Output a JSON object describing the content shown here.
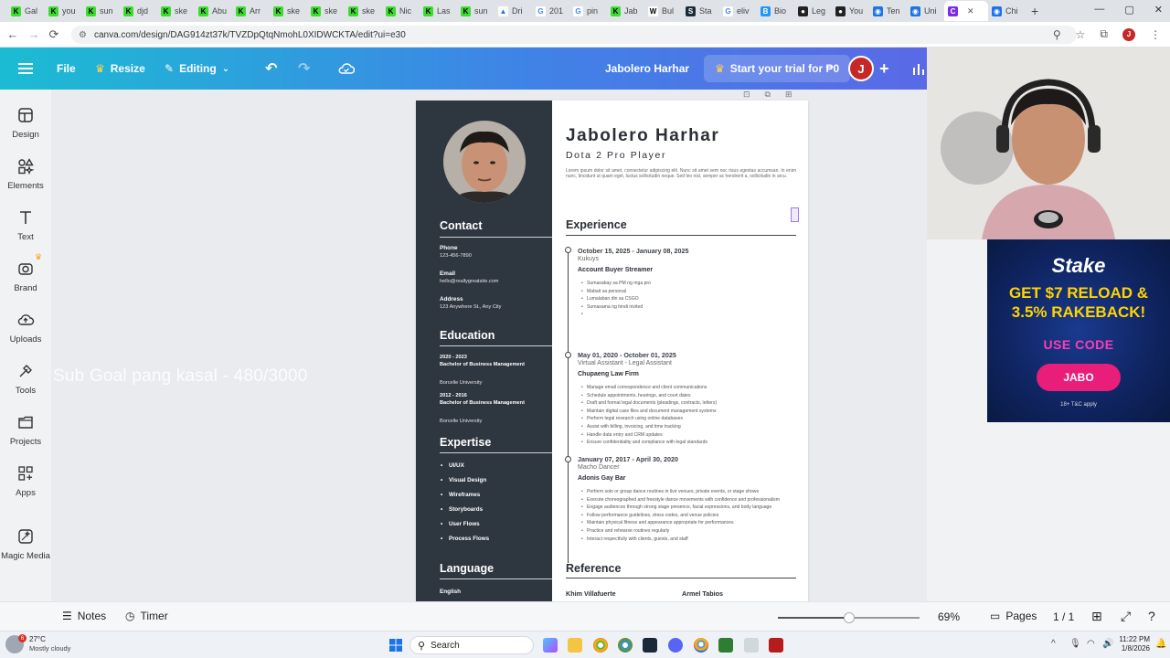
{
  "browser": {
    "tabs": [
      {
        "label": "Gal",
        "icon": "green-k-favicon"
      },
      {
        "label": "you",
        "icon": "green-k-favicon"
      },
      {
        "label": "sun",
        "icon": "green-k-favicon"
      },
      {
        "label": "djd",
        "icon": "green-k-favicon"
      },
      {
        "label": "ske",
        "icon": "green-k-favicon"
      },
      {
        "label": "Abu",
        "icon": "green-k-favicon"
      },
      {
        "label": "Arr",
        "icon": "green-k-favicon"
      },
      {
        "label": "ske",
        "icon": "green-k-favicon"
      },
      {
        "label": "ske",
        "icon": "green-k-favicon"
      },
      {
        "label": "ske",
        "icon": "green-k-favicon"
      },
      {
        "label": "Nic",
        "icon": "green-k-favicon"
      },
      {
        "label": "Las",
        "icon": "green-k-favicon"
      },
      {
        "label": "sun",
        "icon": "green-k-favicon"
      },
      {
        "label": "Dri",
        "icon": "drive-favicon"
      },
      {
        "label": "201",
        "icon": "google-favicon"
      },
      {
        "label": "pin",
        "icon": "google-favicon"
      },
      {
        "label": "Jab",
        "icon": "green-k-favicon"
      },
      {
        "label": "Bul",
        "icon": "wikipedia-favicon"
      },
      {
        "label": "Sta",
        "icon": "stake-favicon"
      },
      {
        "label": "eliv",
        "icon": "google-favicon"
      },
      {
        "label": "Bio",
        "icon": "bio-favicon"
      },
      {
        "label": "Leg",
        "icon": "github-favicon"
      },
      {
        "label": "You",
        "icon": "github-favicon"
      },
      {
        "label": "Ten",
        "icon": "globe-favicon"
      },
      {
        "label": "Uni",
        "icon": "globe-favicon"
      },
      {
        "label": "",
        "icon": "canva-favicon",
        "active": true
      },
      {
        "label": "Chi",
        "icon": "globe-favicon"
      }
    ],
    "url": "canva.com/design/DAG914zt37k/TVZDpQtqNmohL0XIDWCKTA/edit?ui=e30"
  },
  "canva_header": {
    "file_label": "File",
    "resize_label": "Resize",
    "editing_label": "Editing",
    "doc_title": "Jabolero Harhar",
    "trial_label": "Start your trial for ₱0",
    "avatar_letter": "J"
  },
  "sidebar": {
    "items": [
      {
        "label": "Design",
        "icon": "design-icon"
      },
      {
        "label": "Elements",
        "icon": "elements-icon"
      },
      {
        "label": "Text",
        "icon": "text-icon"
      },
      {
        "label": "Brand",
        "icon": "brand-icon"
      },
      {
        "label": "Uploads",
        "icon": "uploads-icon"
      },
      {
        "label": "Tools",
        "icon": "tools-icon"
      },
      {
        "label": "Projects",
        "icon": "projects-icon"
      },
      {
        "label": "Apps",
        "icon": "apps-icon"
      },
      {
        "label": "Magic Media",
        "icon": "magic-media-icon"
      }
    ]
  },
  "overlay_text": "Sub Goal pang kasal - 480/3000",
  "resume": {
    "name": "Jabolero Harhar",
    "role": "Dota 2 Pro Player",
    "summary": "Lorem ipsum dolor sit amet, consectetur adipiscing elit. Nunc sit amet sem nec risus egestas accumsan. In enim nunc, tincidunt ut quam eget, luctus sollicitudin neque. Sed leo nisl, semper ac hendrerit a, sollicitudin in arcu.",
    "contact": {
      "heading": "Contact",
      "phone_label": "Phone",
      "phone": "123-456-7890",
      "email_label": "Email",
      "email": "hello@reallygreatsite.com",
      "address_label": "Address",
      "address": "123 Anywhere St., Any City"
    },
    "education": {
      "heading": "Education",
      "entries": [
        {
          "years": "2020 - 2023",
          "degree": "Bachelor of Business Management",
          "school": "Borcelle University"
        },
        {
          "years": "2012 - 2016",
          "degree": "Bachelor of Business Management",
          "school": "Borcelle University"
        }
      ]
    },
    "expertise": {
      "heading": "Expertise",
      "items": [
        "UI/UX",
        "Visual Design",
        "Wireframes",
        "Storyboards",
        "User Flows",
        "Process Flows"
      ]
    },
    "language": {
      "heading": "Language",
      "items": [
        "English"
      ]
    },
    "experience": {
      "heading": "Experience",
      "jobs": [
        {
          "dates": "October 15, 2025 - January 08, 2025",
          "title": "Kukuys",
          "company": "Account Buyer Streamer",
          "duties": [
            "Sumasabay sa PM ng mga pro",
            "Mabait sa personal",
            "Lumalaban din sa CSGO",
            "Sumasama ng hindi invited",
            ""
          ]
        },
        {
          "dates": "May 01, 2020 - October 01, 2025",
          "title": "Virtual Assistant - Legal Assistant",
          "company": "Chupaeng Law Firm",
          "duties": [
            "Manage email correspondence and client communications",
            "Schedule appointments, hearings, and court dates",
            "Draft and format legal documents (pleadings, contracts, letters)",
            "Maintain digital case files and document management systems",
            "Perform legal research using online databases",
            "Assist with billing, invoicing, and time tracking",
            "Handle data entry and CRM updates",
            "Ensure confidentiality and compliance with legal standards"
          ]
        },
        {
          "dates": "January 07, 2017 - April 30, 2020",
          "title": "Macho Dancer",
          "company": "Adonis Gay Bar",
          "duties": [
            "Perform solo or group dance routines in live venues, private events, or stage shows",
            "Execute choreographed and freestyle dance movements with confidence and professionalism",
            "Engage audiences through strong stage presence, facial expressions, and body language",
            "Follow performance guidelines, dress codes, and venue policies",
            "Maintain physical fitness and appearance appropriate for performances",
            "Practice and rehearse routines regularly",
            "Interact respectfully with clients, guests, and staff"
          ]
        }
      ]
    },
    "reference": {
      "heading": "Reference",
      "names": [
        "Khim Villafuerte",
        "Armel Tabios"
      ]
    }
  },
  "ad": {
    "brand": "Stake",
    "headline": "GET $7 RELOAD & 3.5% RAKEBACK!",
    "use_code": "USE CODE",
    "code": "JABO",
    "fine_print": "18+ T&C apply"
  },
  "bottom_bar": {
    "notes_label": "Notes",
    "timer_label": "Timer",
    "zoom_percent": "69%",
    "zoom_level": 0.5,
    "pages_label": "Pages",
    "page_counter": "1 / 1"
  },
  "taskbar": {
    "weather_temp": "27°C",
    "weather_desc": "Mostly cloudy",
    "weather_badge": "6",
    "search_label": "Search",
    "time": "11:22 PM",
    "date": "1/8/2026"
  },
  "colors": {
    "header_gradient_start": "#1bbcd3",
    "header_gradient_end": "#6a5ae6",
    "resume_sidebar": "#2e3640",
    "avatar_red": "#c62828",
    "ad_yellow": "#ffd400",
    "ad_pink": "#e81e7a"
  }
}
